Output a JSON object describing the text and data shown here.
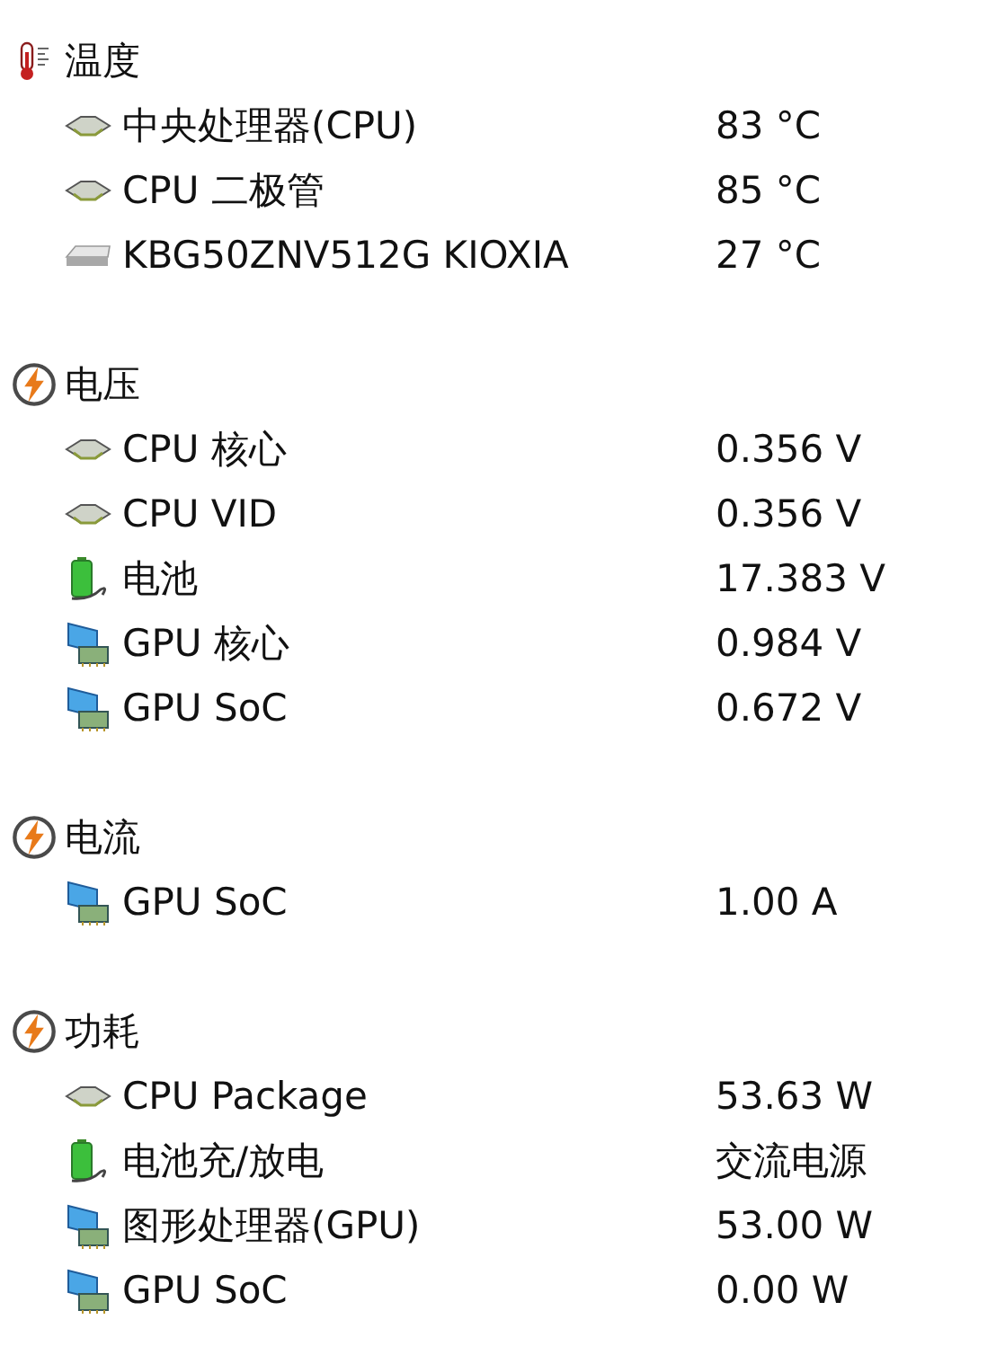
{
  "sections": [
    {
      "title": "温度",
      "kind": "temperature",
      "rows": [
        {
          "kind": "cpu",
          "name": "中央处理器(CPU)",
          "value": "83 °C"
        },
        {
          "kind": "cpu",
          "name": "CPU 二极管",
          "value": "85 °C"
        },
        {
          "kind": "drive",
          "name": "KBG50ZNV512G KIOXIA",
          "value": "27 °C"
        }
      ]
    },
    {
      "title": "电压",
      "kind": "power",
      "rows": [
        {
          "kind": "cpu",
          "name": "CPU 核心",
          "value": "0.356 V"
        },
        {
          "kind": "cpu",
          "name": "CPU VID",
          "value": "0.356 V"
        },
        {
          "kind": "battery",
          "name": "电池",
          "value": "17.383 V"
        },
        {
          "kind": "gpu",
          "name": "GPU 核心",
          "value": "0.984 V"
        },
        {
          "kind": "gpu",
          "name": "GPU SoC",
          "value": "0.672 V"
        }
      ]
    },
    {
      "title": "电流",
      "kind": "power",
      "rows": [
        {
          "kind": "gpu",
          "name": "GPU SoC",
          "value": "1.00 A"
        }
      ]
    },
    {
      "title": "功耗",
      "kind": "power",
      "rows": [
        {
          "kind": "cpu",
          "name": "CPU Package",
          "value": "53.63 W"
        },
        {
          "kind": "battery",
          "name": "电池充/放电",
          "value": "交流电源"
        },
        {
          "kind": "gpu",
          "name": "图形处理器(GPU)",
          "value": "53.00 W"
        },
        {
          "kind": "gpu",
          "name": "GPU SoC",
          "value": "0.00 W"
        }
      ]
    }
  ]
}
